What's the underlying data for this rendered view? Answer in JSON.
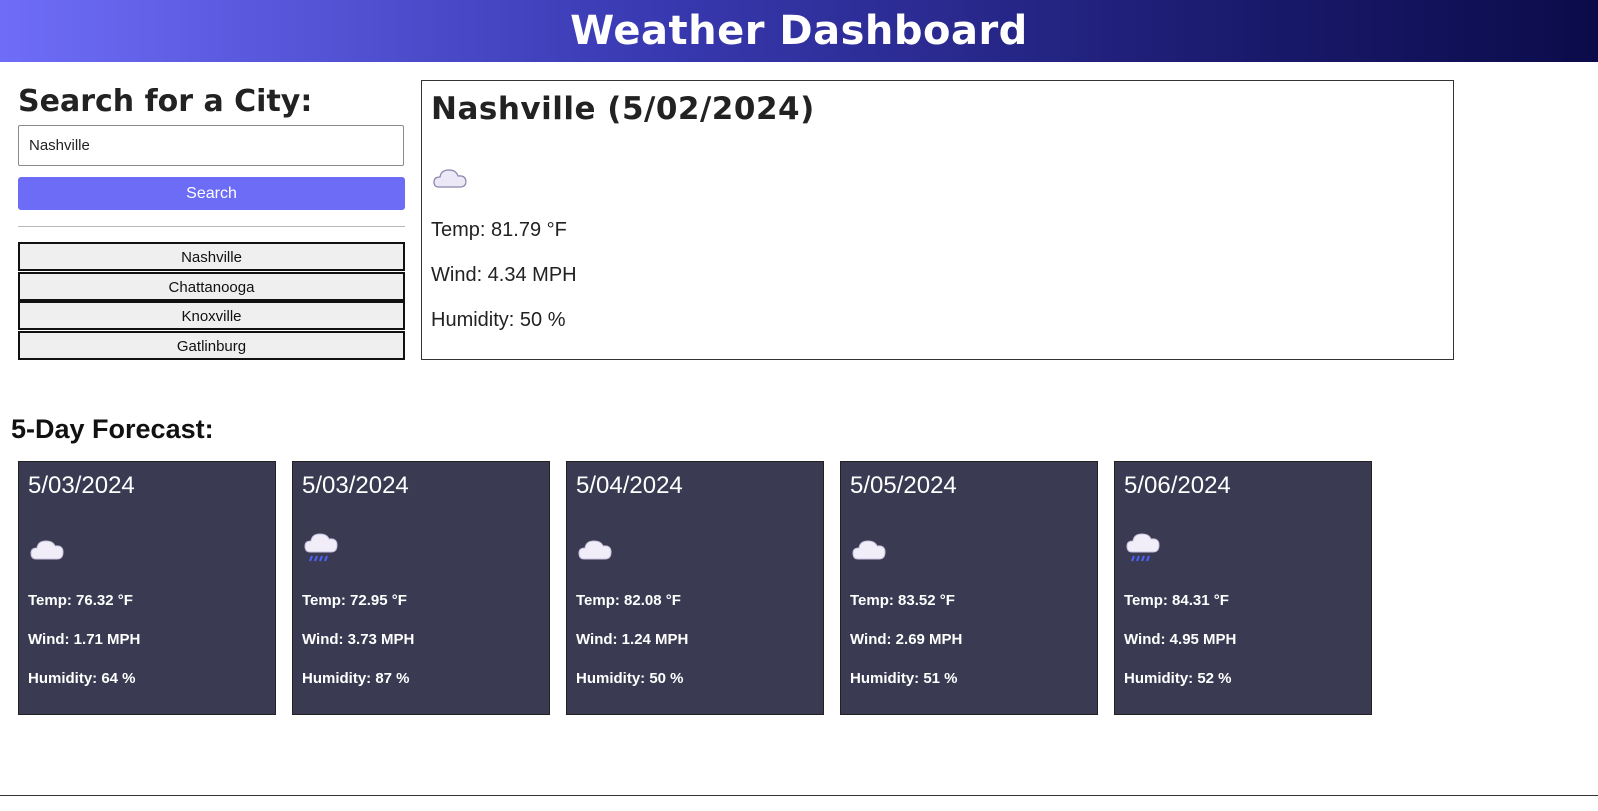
{
  "header": {
    "title": "Weather Dashboard"
  },
  "search": {
    "title": "Search for a City:",
    "input_value": "Nashville",
    "button_label": "Search",
    "history": [
      "Nashville",
      "Chattanooga",
      "Knoxville",
      "Gatlinburg"
    ]
  },
  "current": {
    "heading": "Nashville (5/02/2024)",
    "icon": "cloud-icon",
    "temp": "Temp: 81.79 °F",
    "wind": "Wind: 4.34 MPH",
    "humidity": "Humidity: 50 %"
  },
  "forecast": {
    "title": "5-Day Forecast:",
    "days": [
      {
        "date": "5/03/2024",
        "icon": "cloud-icon",
        "temp": "Temp: 76.32 °F",
        "wind": "Wind: 1.71 MPH",
        "humidity": "Humidity: 64 %"
      },
      {
        "date": "5/03/2024",
        "icon": "rain-cloud-icon",
        "temp": "Temp: 72.95 °F",
        "wind": "Wind: 3.73 MPH",
        "humidity": "Humidity: 87 %"
      },
      {
        "date": "5/04/2024",
        "icon": "cloud-icon",
        "temp": "Temp: 82.08 °F",
        "wind": "Wind: 1.24 MPH",
        "humidity": "Humidity: 50 %"
      },
      {
        "date": "5/05/2024",
        "icon": "cloud-icon",
        "temp": "Temp: 83.52 °F",
        "wind": "Wind: 2.69 MPH",
        "humidity": "Humidity: 51 %"
      },
      {
        "date": "5/06/2024",
        "icon": "rain-cloud-icon",
        "temp": "Temp: 84.31 °F",
        "wind": "Wind: 4.95 MPH",
        "humidity": "Humidity: 52 %"
      }
    ]
  },
  "colors": {
    "header_gradient_start": "#6e6df8",
    "header_gradient_end": "#0b0b4a",
    "search_button": "#6c6cf7",
    "card_background": "#3a3a53"
  }
}
